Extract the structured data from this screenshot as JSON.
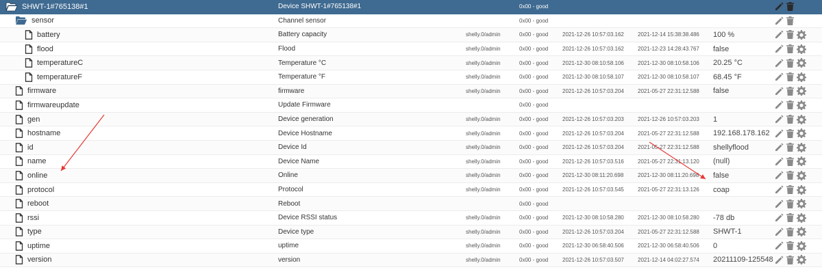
{
  "rows": [
    {
      "name": "SHWT-1#765138#1",
      "type": "folder",
      "depth": 0,
      "desc": "Device SHWT-1#765138#1",
      "user": "",
      "quality": "0x00 - good",
      "ts": "",
      "lc": "",
      "value": "",
      "selected": true,
      "settings": false
    },
    {
      "name": "sensor",
      "type": "folder",
      "depth": 1,
      "desc": "Channel sensor",
      "user": "",
      "quality": "0x00 - good",
      "ts": "",
      "lc": "",
      "value": "",
      "settings": false
    },
    {
      "name": "battery",
      "type": "file",
      "depth": 2,
      "desc": "Battery capacity",
      "user": "shelly.0/admin",
      "quality": "0x00 - good",
      "ts": "2021-12-26 10:57:03.162",
      "lc": "2021-12-14 15:38:38.486",
      "value": "100 %",
      "settings": true
    },
    {
      "name": "flood",
      "type": "file",
      "depth": 2,
      "desc": "Flood",
      "user": "shelly.0/admin",
      "quality": "0x00 - good",
      "ts": "2021-12-26 10:57:03.162",
      "lc": "2021-12-23 14:28:43.767",
      "value": "false",
      "settings": true
    },
    {
      "name": "temperatureC",
      "type": "file",
      "depth": 2,
      "desc": "Temperature °C",
      "user": "shelly.0/admin",
      "quality": "0x00 - good",
      "ts": "2021-12-30 08:10:58.106",
      "lc": "2021-12-30 08:10:58.106",
      "value": "20.25 °C",
      "settings": true
    },
    {
      "name": "temperatureF",
      "type": "file",
      "depth": 2,
      "desc": "Temperature °F",
      "user": "shelly.0/admin",
      "quality": "0x00 - good",
      "ts": "2021-12-30 08:10:58.107",
      "lc": "2021-12-30 08:10:58.107",
      "value": "68.45 °F",
      "settings": true
    },
    {
      "name": "firmware",
      "type": "file",
      "depth": 1,
      "desc": "firmware",
      "user": "shelly.0/admin",
      "quality": "0x00 - good",
      "ts": "2021-12-26 10:57:03.204",
      "lc": "2021-05-27 22:31:12.588",
      "value": "false",
      "settings": true
    },
    {
      "name": "firmwareupdate",
      "type": "file",
      "depth": 1,
      "desc": "Update Firmware",
      "user": "",
      "quality": "0x00 - good",
      "ts": "",
      "lc": "",
      "value": "",
      "settings": true
    },
    {
      "name": "gen",
      "type": "file",
      "depth": 1,
      "desc": "Device generation",
      "user": "shelly.0/admin",
      "quality": "0x00 - good",
      "ts": "2021-12-26 10:57:03.203",
      "lc": "2021-12-26 10:57:03.203",
      "value": "1",
      "settings": true
    },
    {
      "name": "hostname",
      "type": "file",
      "depth": 1,
      "desc": "Device Hostname",
      "user": "shelly.0/admin",
      "quality": "0x00 - good",
      "ts": "2021-12-26 10:57:03.204",
      "lc": "2021-05-27 22:31:12.588",
      "value": "192.168.178.162",
      "settings": true
    },
    {
      "name": "id",
      "type": "file",
      "depth": 1,
      "desc": "Device Id",
      "user": "shelly.0/admin",
      "quality": "0x00 - good",
      "ts": "2021-12-26 10:57:03.204",
      "lc": "2021-05-27 22:31:12.588",
      "value": "shellyflood",
      "settings": true
    },
    {
      "name": "name",
      "type": "file",
      "depth": 1,
      "desc": "Device Name",
      "user": "shelly.0/admin",
      "quality": "0x00 - good",
      "ts": "2021-12-26 10:57:03.516",
      "lc": "2021-05-27 22:31:13.120",
      "value": "(null)",
      "settings": true
    },
    {
      "name": "online",
      "type": "file",
      "depth": 1,
      "desc": "Online",
      "user": "shelly.0/admin",
      "quality": "0x00 - good",
      "ts": "2021-12-30 08:11:20.698",
      "lc": "2021-12-30 08:11:20.698",
      "value": "false",
      "settings": true
    },
    {
      "name": "protocol",
      "type": "file",
      "depth": 1,
      "desc": "Protocol",
      "user": "shelly.0/admin",
      "quality": "0x00 - good",
      "ts": "2021-12-26 10:57:03.545",
      "lc": "2021-05-27 22:31:13.126",
      "value": "coap",
      "settings": true
    },
    {
      "name": "reboot",
      "type": "file",
      "depth": 1,
      "desc": "Reboot",
      "user": "",
      "quality": "0x00 - good",
      "ts": "",
      "lc": "",
      "value": "",
      "settings": true
    },
    {
      "name": "rssi",
      "type": "file",
      "depth": 1,
      "desc": "Device RSSI status",
      "user": "shelly.0/admin",
      "quality": "0x00 - good",
      "ts": "2021-12-30 08:10:58.280",
      "lc": "2021-12-30 08:10:58.280",
      "value": "-78 db",
      "settings": true
    },
    {
      "name": "type",
      "type": "file",
      "depth": 1,
      "desc": "Device type",
      "user": "shelly.0/admin",
      "quality": "0x00 - good",
      "ts": "2021-12-26 10:57:03.204",
      "lc": "2021-05-27 22:31:12.588",
      "value": "SHWT-1",
      "settings": true
    },
    {
      "name": "uptime",
      "type": "file",
      "depth": 1,
      "desc": "uptime",
      "user": "shelly.0/admin",
      "quality": "0x00 - good",
      "ts": "2021-12-30 06:58:40.506",
      "lc": "2021-12-30 06:58:40.506",
      "value": "0",
      "settings": true
    },
    {
      "name": "version",
      "type": "file",
      "depth": 1,
      "desc": "version",
      "user": "shelly.0/admin",
      "quality": "0x00 - good",
      "ts": "2021-12-26 10:57:03.507",
      "lc": "2021-12-14 04:02:27.574",
      "value": "20211109-125548...",
      "settings": true
    }
  ],
  "colors": {
    "selected_row": "#3f6a91",
    "annotation_arrow": "#e53935",
    "icon_gray": "#8a8a8a"
  },
  "icons": {
    "folder": "folder-open-icon",
    "file": "file-icon",
    "edit": "pencil-icon",
    "delete": "trash-icon",
    "settings": "gear-icon"
  }
}
